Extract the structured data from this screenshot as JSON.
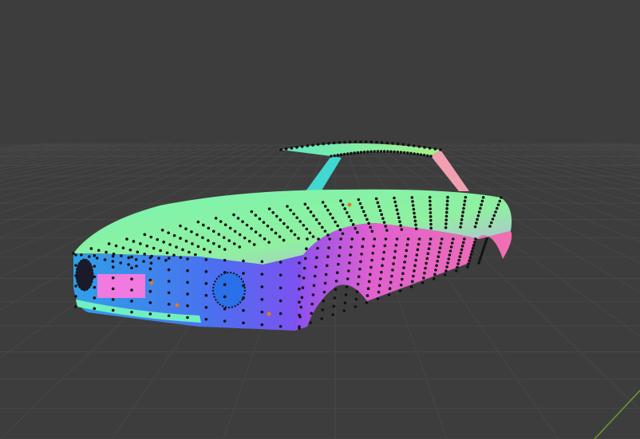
{
  "viewport": {
    "mode": "edit-mode-mesh",
    "colors": {
      "background": "#3d3d3d",
      "grid": "#4a4a4a",
      "y_axis": "#6f9a2a",
      "vertex": "#111111",
      "selected_vertex": "#e07a20",
      "normal_top": "#6ef0a0",
      "normal_side": "#f060c0",
      "normal_front": "#3a8cf0",
      "normal_purple": "#9a50f0"
    }
  }
}
